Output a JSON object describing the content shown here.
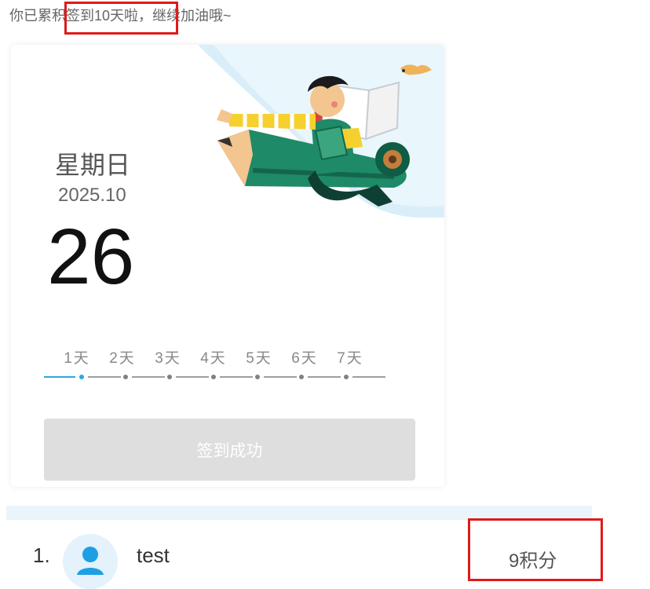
{
  "header": {
    "message": "你已累积签到10天啦，继续加油哦~"
  },
  "card": {
    "weekday": "星期日",
    "year_month": "2025.10",
    "day": "26",
    "days": [
      "1天",
      "2天",
      "3天",
      "4天",
      "5天",
      "6天",
      "7天"
    ],
    "progress_current_day": 1,
    "button_label": "签到成功"
  },
  "ranking": {
    "items": [
      {
        "rank": "1.",
        "name": "test",
        "points": "9积分"
      }
    ]
  },
  "colors": {
    "accent": "#2ea7e0",
    "highlight_box": "#e01a1a",
    "button_disabled": "#dedede"
  }
}
